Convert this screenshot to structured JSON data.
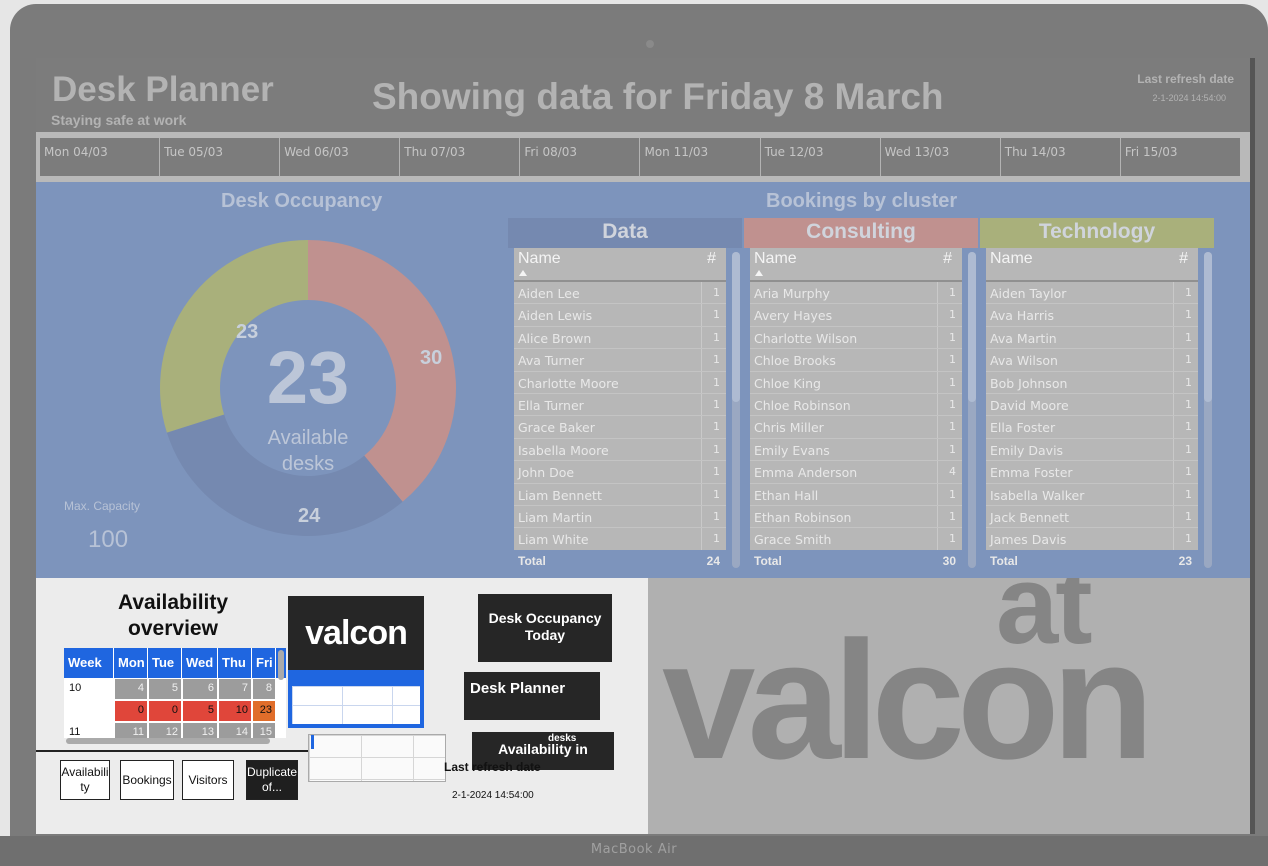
{
  "device_label": "MacBook Air",
  "header": {
    "title": "Desk Planner",
    "subtitle": "Staying safe at work",
    "showing": "Showing data for Friday 8 March",
    "refresh_label": "Last refresh date",
    "refresh_value": "2-1-2024 14:54:00"
  },
  "dates": [
    "Mon 04/03",
    "Tue 05/03",
    "Wed 06/03",
    "Thu 07/03",
    "Fri 08/03",
    "Mon 11/03",
    "Tue 12/03",
    "Wed 13/03",
    "Thu 14/03",
    "Fri 15/03"
  ],
  "occupancy": {
    "title": "Desk Occupancy",
    "center_value": "23",
    "center_label_1": "Available",
    "center_label_2": "desks",
    "max_capacity_label": "Max. Capacity",
    "max_capacity_value": "100",
    "labels": {
      "consulting": "30",
      "data": "24",
      "available": "23"
    }
  },
  "chart_data": {
    "type": "pie",
    "categories": [
      "Consulting",
      "Data",
      "Available"
    ],
    "values": [
      30,
      24,
      23
    ],
    "colors": [
      "#c0918f",
      "#7589b0",
      "#a9b07b"
    ]
  },
  "bookings": {
    "title": "Bookings by cluster",
    "clusters": [
      {
        "name": "Data",
        "color": "#7589b0",
        "col_name": "Name",
        "col_count": "#",
        "rows": [
          [
            "Aiden Lee",
            "1"
          ],
          [
            "Aiden Lewis",
            "1"
          ],
          [
            "Alice Brown",
            "1"
          ],
          [
            "Ava Turner",
            "1"
          ],
          [
            "Charlotte Moore",
            "1"
          ],
          [
            "Ella Turner",
            "1"
          ],
          [
            "Grace Baker",
            "1"
          ],
          [
            "Isabella Moore",
            "1"
          ],
          [
            "John Doe",
            "1"
          ],
          [
            "Liam Bennett",
            "1"
          ],
          [
            "Liam Martin",
            "1"
          ],
          [
            "Liam White",
            "1"
          ]
        ],
        "total_label": "Total",
        "total": "24",
        "sort_caret": true
      },
      {
        "name": "Consulting",
        "color": "#c0918f",
        "col_name": "Name",
        "col_count": "#",
        "rows": [
          [
            "Aria Murphy",
            "1"
          ],
          [
            "Avery Hayes",
            "1"
          ],
          [
            "Charlotte Wilson",
            "1"
          ],
          [
            "Chloe Brooks",
            "1"
          ],
          [
            "Chloe King",
            "1"
          ],
          [
            "Chloe Robinson",
            "1"
          ],
          [
            "Chris Miller",
            "1"
          ],
          [
            "Emily Evans",
            "1"
          ],
          [
            "Emma Anderson",
            "4"
          ],
          [
            "Ethan Hall",
            "1"
          ],
          [
            "Ethan Robinson",
            "1"
          ],
          [
            "Grace Smith",
            "1"
          ]
        ],
        "total_label": "Total",
        "total": "30",
        "sort_caret": true
      },
      {
        "name": "Technology",
        "color": "#a9b07b",
        "col_name": "Name",
        "col_count": "#",
        "rows": [
          [
            "Aiden Taylor",
            "1"
          ],
          [
            "Ava Harris",
            "1"
          ],
          [
            "Ava Martin",
            "1"
          ],
          [
            "Ava Wilson",
            "1"
          ],
          [
            "Bob Johnson",
            "1"
          ],
          [
            "David Moore",
            "1"
          ],
          [
            "Ella Foster",
            "1"
          ],
          [
            "Emily Davis",
            "1"
          ],
          [
            "Emma Foster",
            "1"
          ],
          [
            "Isabella Walker",
            "1"
          ],
          [
            "Jack Bennett",
            "1"
          ],
          [
            "James Davis",
            "1"
          ]
        ],
        "total_label": "Total",
        "total": "23",
        "sort_caret": false
      }
    ]
  },
  "availability": {
    "title_1": "Availability",
    "title_2": "overview",
    "headers": [
      "Week",
      "Mon",
      "Tue",
      "Wed",
      "Thu",
      "Fri"
    ],
    "week": "10",
    "grey_row": [
      "4",
      "5",
      "6",
      "7",
      "8"
    ],
    "red_row": [
      "0",
      "0",
      "5",
      "10",
      "23"
    ],
    "next_week": "11",
    "next_row": [
      "11",
      "12",
      "13",
      "14",
      "15"
    ]
  },
  "nav_buttons": [
    "Availabili ty",
    "Bookings",
    "Visitors",
    "Duplicate of..."
  ],
  "tiles": {
    "valcon": "valcon",
    "desk_occupancy_today": "Desk Occupancy Today",
    "desk_planner": "Desk Planner",
    "desks": "desks",
    "availability_in": "Availability in",
    "refresh_label": "Last refresh date",
    "refresh_value": "2-1-2024 14:54:00"
  },
  "logo": {
    "at": "at",
    "valcon": "valcon"
  }
}
